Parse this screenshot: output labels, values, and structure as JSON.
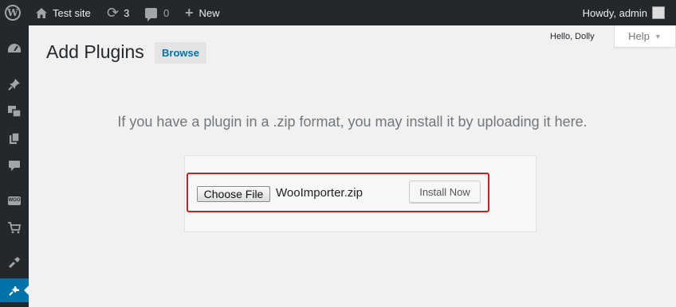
{
  "adminbar": {
    "site_name": "Test site",
    "updates_count": "3",
    "comments_count": "0",
    "new_label": "New",
    "howdy": "Howdy, admin"
  },
  "screen_meta": {
    "hello_dolly": "Hello, Dolly",
    "help_label": "Help"
  },
  "page": {
    "title": "Add Plugins",
    "browse_label": "Browse",
    "upload_help": "If you have a plugin in a .zip format, you may install it by uploading it here."
  },
  "upload_form": {
    "choose_file_label": "Choose File",
    "file_name": "WooImporter.zip",
    "install_label": "Install Now"
  },
  "menu": {
    "icons": [
      "dashboard-icon",
      "pin-icon",
      "media-icon",
      "pages-icon",
      "comments-icon",
      "woocommerce-icon",
      "cart-icon",
      "appearance-icon",
      "plugins-icon"
    ],
    "woo_text": "WOO"
  },
  "colors": {
    "adminbar_bg": "#23282d",
    "accent": "#0073aa",
    "highlight": "#c92020"
  }
}
